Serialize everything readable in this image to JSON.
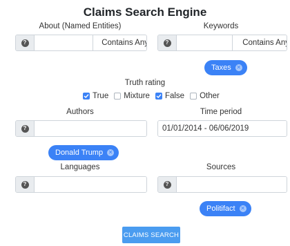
{
  "title": "Claims Search Engine",
  "about": {
    "label": "About (Named Entities)",
    "value": "",
    "match": "Contains Any"
  },
  "keywords": {
    "label": "Keywords",
    "value": "",
    "match": "Contains Any",
    "chips": [
      "Taxes"
    ]
  },
  "truth": {
    "label": "Truth rating",
    "options": [
      {
        "label": "True",
        "checked": true
      },
      {
        "label": "Mixture",
        "checked": false
      },
      {
        "label": "False",
        "checked": true
      },
      {
        "label": "Other",
        "checked": false
      }
    ]
  },
  "authors": {
    "label": "Authors",
    "value": "",
    "chips": [
      "Donald Trump"
    ]
  },
  "time": {
    "label": "Time period",
    "value": "01/01/2014 - 06/06/2019"
  },
  "languages": {
    "label": "Languages",
    "value": ""
  },
  "sources": {
    "label": "Sources",
    "value": "",
    "chips": [
      "Politifact"
    ]
  },
  "submit": {
    "label": "CLAIMS SEARCH"
  },
  "icons": {
    "help": "question-circle-icon",
    "chip_remove": "close-circle-icon",
    "checkbox": "check-icon",
    "select": "caret-down-icon"
  },
  "colors": {
    "accent": "#3b82f6",
    "button": "#4a9cf0"
  }
}
